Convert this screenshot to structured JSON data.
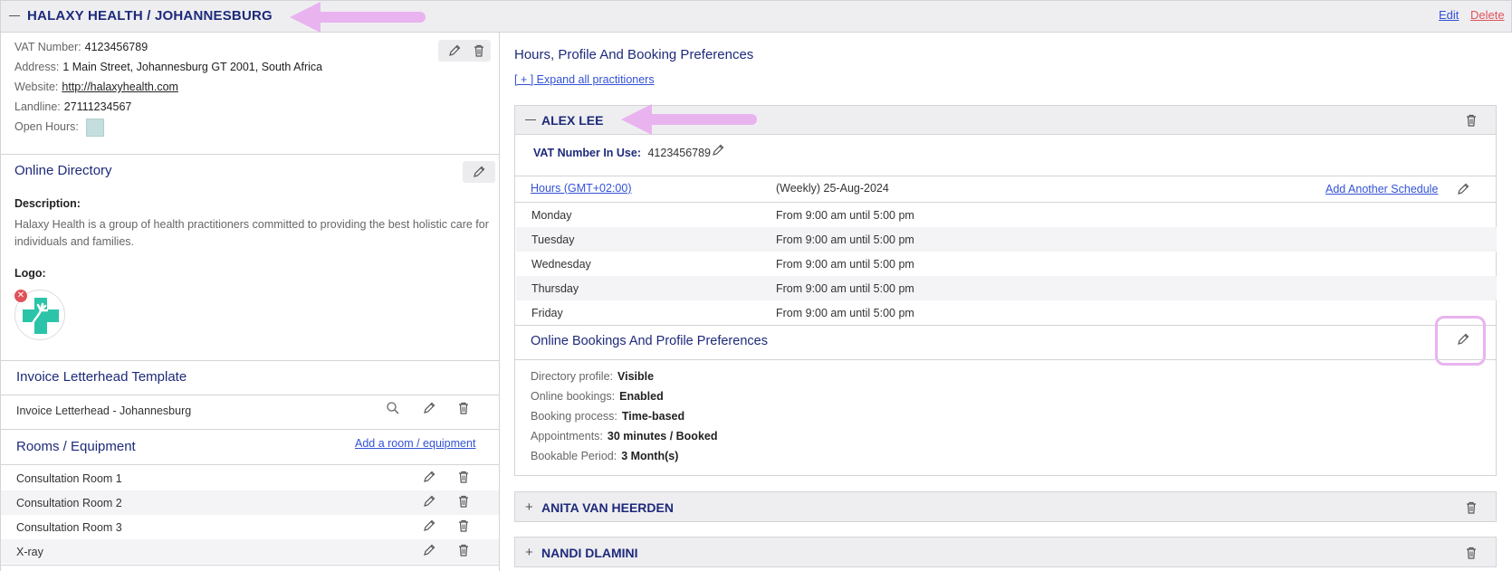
{
  "org": {
    "title": "HALAXY HEALTH / JOHANNESBURG",
    "edit_label": "Edit",
    "delete_label": "Delete"
  },
  "details": {
    "vat_label": "VAT Number:",
    "vat_value": "4123456789",
    "address_label": "Address:",
    "address_value": "1 Main Street, Johannesburg GT 2001, South Africa",
    "website_label": "Website:",
    "website_value": "http://halaxyhealth.com",
    "landline_label": "Landline:",
    "landline_value": "27111234567",
    "open_hours_label": "Open Hours:"
  },
  "directory": {
    "title": "Online Directory",
    "description_label": "Description:",
    "description_text": "Halaxy Health is a group of health practitioners committed to providing the best holistic care for individuals and families.",
    "logo_label": "Logo:"
  },
  "letterhead": {
    "title": "Invoice Letterhead Template",
    "item": "Invoice Letterhead - Johannesburg"
  },
  "rooms": {
    "title": "Rooms / Equipment",
    "add_label": "Add a room / equipment",
    "items": [
      "Consultation Room 1",
      "Consultation Room 2",
      "Consultation Room 3",
      "X-ray"
    ]
  },
  "right": {
    "title": "Hours, Profile And Booking Preferences",
    "expand_all": "[ + ] Expand all practitioners"
  },
  "practitioner": {
    "name": "ALEX LEE",
    "vat_in_use_label": "VAT Number In Use:",
    "vat_in_use_value": "4123456789",
    "hours_link": "Hours (GMT+02:00)",
    "schedule": "(Weekly) 25-Aug-2024",
    "add_schedule": "Add Another Schedule",
    "hours": [
      {
        "day": "Monday",
        "time": "From 9:00 am until 5:00 pm"
      },
      {
        "day": "Tuesday",
        "time": "From 9:00 am until 5:00 pm"
      },
      {
        "day": "Wednesday",
        "time": "From 9:00 am until 5:00 pm"
      },
      {
        "day": "Thursday",
        "time": "From 9:00 am until 5:00 pm"
      },
      {
        "day": "Friday",
        "time": "From 9:00 am until 5:00 pm"
      }
    ],
    "prefs_title": "Online Bookings And Profile Preferences",
    "prefs": [
      {
        "label": "Directory profile:",
        "value": "Visible"
      },
      {
        "label": "Online bookings:",
        "value": "Enabled"
      },
      {
        "label": "Booking process:",
        "value": "Time-based"
      },
      {
        "label": "Appointments:",
        "value": "30 minutes / Booked"
      },
      {
        "label": "Bookable Period:",
        "value": "3 Month(s)"
      }
    ]
  },
  "other_practitioners": [
    "ANITA VAN HEERDEN",
    "NANDI DLAMINI"
  ],
  "colors": {
    "navy": "#1e2a7a",
    "link": "#3352d6",
    "delete": "#e0525a",
    "annotation": "#e9b3f0",
    "logo_teal": "#2cc4a8"
  }
}
